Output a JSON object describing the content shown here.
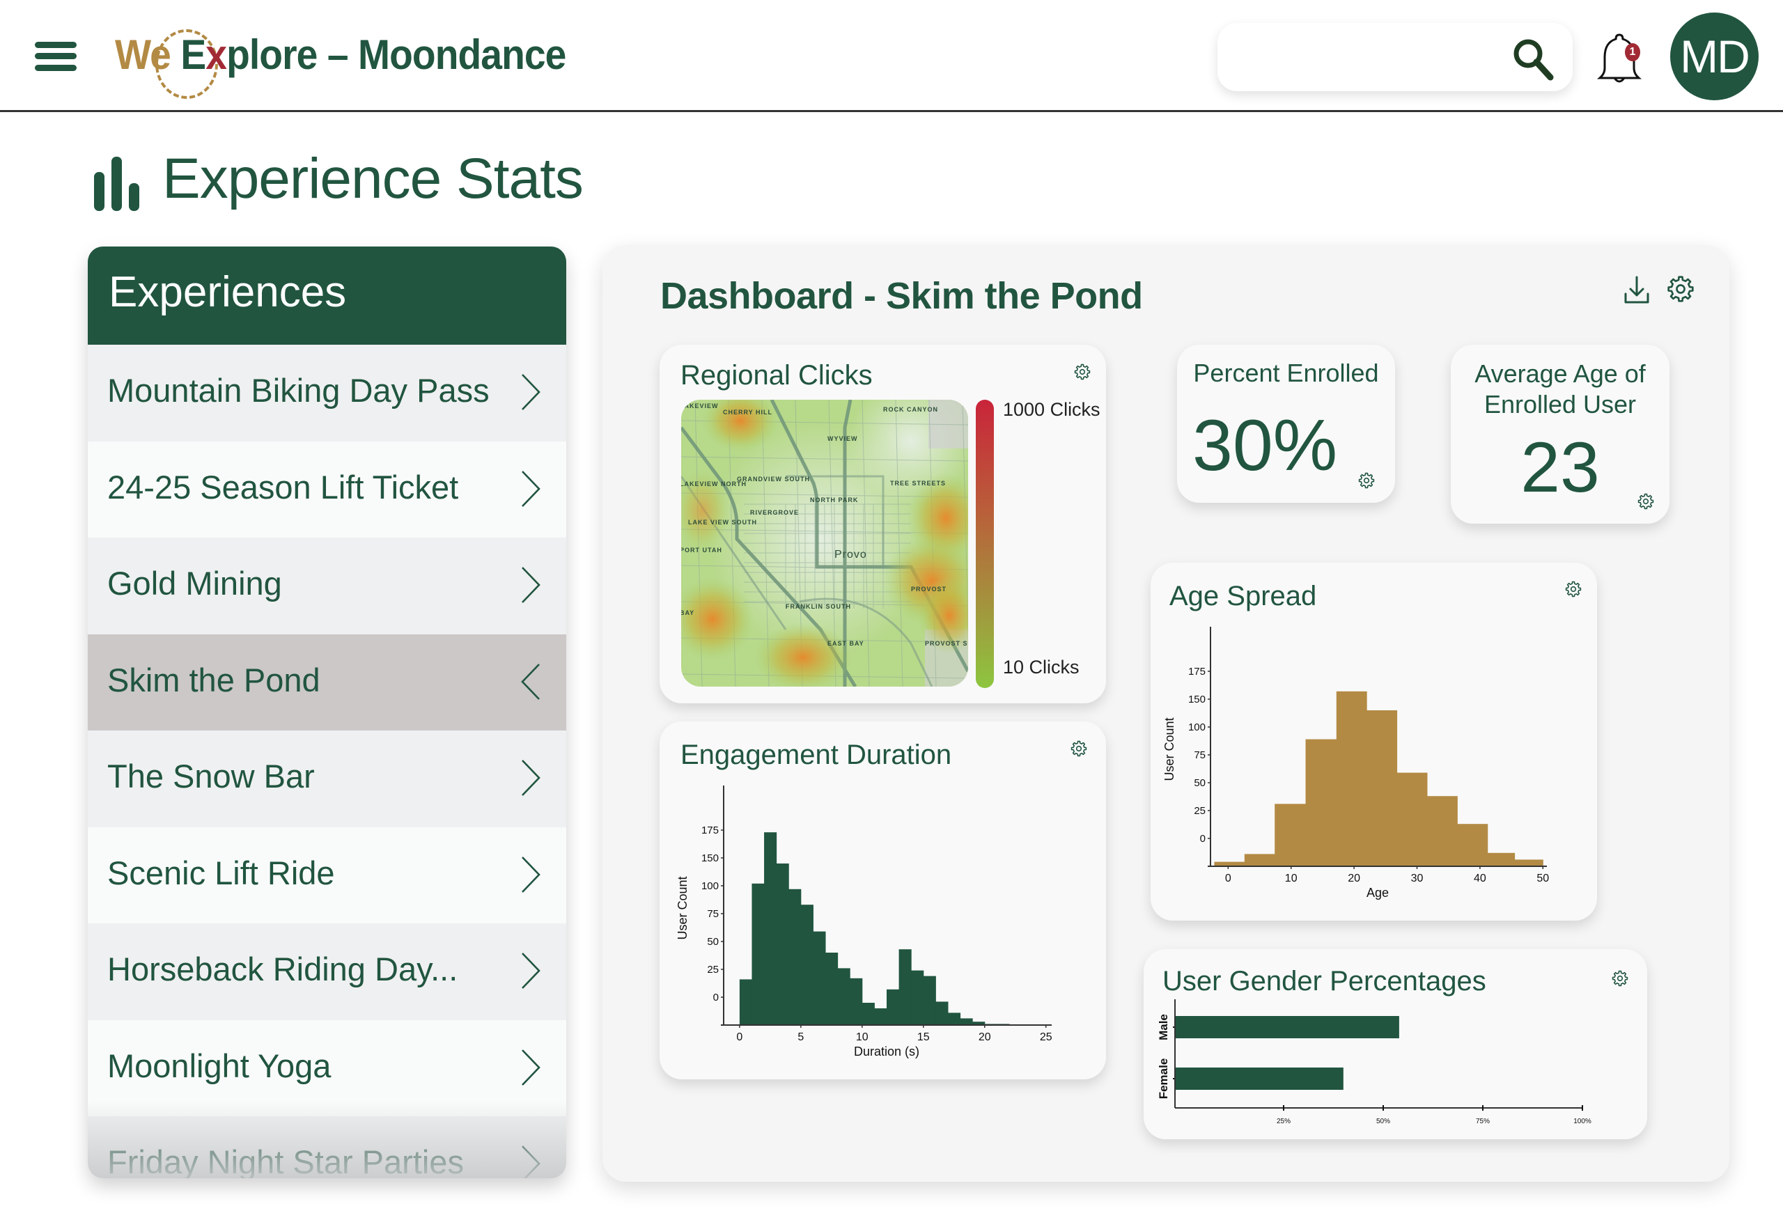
{
  "header": {
    "menu_icon": "hamburger-menu-icon",
    "logo": {
      "part1": "We",
      "part2": "E",
      "part3": "x",
      "part4": "plore – Moondance"
    },
    "search": {
      "value": "",
      "placeholder": "",
      "icon": "search-icon"
    },
    "notifications": {
      "icon": "bell-icon",
      "count": "1"
    },
    "avatar_initials": "MD"
  },
  "page": {
    "title_icon": "bar-chart-icon",
    "title": "Experience Stats"
  },
  "sidebar": {
    "heading": "Experiences",
    "items": [
      {
        "label": "Mountain Biking Day Pass",
        "active": false,
        "icon": "chevron-right-icon"
      },
      {
        "label": "24-25 Season Lift Ticket",
        "active": false,
        "icon": "chevron-right-icon"
      },
      {
        "label": "Gold Mining",
        "active": false,
        "icon": "chevron-right-icon"
      },
      {
        "label": "Skim the Pond",
        "active": true,
        "icon": "chevron-left-icon"
      },
      {
        "label": "The Snow Bar",
        "active": false,
        "icon": "chevron-right-icon"
      },
      {
        "label": "Scenic Lift Ride",
        "active": false,
        "icon": "chevron-right-icon"
      },
      {
        "label": "Horseback Riding Day...",
        "active": false,
        "icon": "chevron-right-icon"
      },
      {
        "label": "Moonlight Yoga",
        "active": false,
        "icon": "chevron-right-icon"
      },
      {
        "label": "Friday Night Star Parties",
        "active": false,
        "icon": "chevron-right-icon"
      }
    ]
  },
  "dashboard": {
    "title": "Dashboard - Skim the Pond",
    "actions": [
      "download-icon",
      "gear-icon"
    ],
    "regional_clicks": {
      "title": "Regional Clicks",
      "legend_max": "1000 Clicks",
      "legend_min": "10 Clicks",
      "colors": {
        "max": "#c9243a",
        "min": "#8dc63f"
      },
      "map_labels": [
        "LAKEVIEW",
        "CHERRY HILL",
        "ROCK CANYON",
        "WYVIEW",
        "GRANDVIEW SOUTH",
        "LAKEVIEW NORTH",
        "TREE STREETS",
        "NORTH PARK",
        "RIVERGROVE",
        "LAKE VIEW SOUTH",
        "PORT UTAH",
        "Provo",
        "PROVOST",
        "FRANKLIN SOUTH",
        "BAY",
        "EAST BAY",
        "PROVOST SO"
      ]
    },
    "percent_enrolled": {
      "title": "Percent Enrolled",
      "value": "30%"
    },
    "average_age": {
      "title": "Average Age of Enrolled User",
      "value": "23"
    }
  },
  "colors": {
    "brand_green": "#215540",
    "brand_gold": "#b38a44",
    "accent_red": "#a12a35",
    "active_row": "#cbc8c7"
  },
  "chart_data": [
    {
      "id": "engagement",
      "type": "bar",
      "title": "Engagement Duration",
      "xlabel": "Duration (s)",
      "ylabel": "User Count",
      "color": "#215540",
      "x_ticks": [
        0,
        5,
        10,
        15,
        20,
        25
      ],
      "y_tick_labels": [
        "0",
        "25",
        "50",
        "75",
        "100",
        "150",
        "175"
      ],
      "xlim": [
        -1.3,
        25.3
      ],
      "ylim": [
        -25,
        185
      ],
      "bins": [
        {
          "x0": 0,
          "x1": 1,
          "value": 16
        },
        {
          "x0": 1,
          "x1": 2,
          "value": 102
        },
        {
          "x0": 2,
          "x1": 3,
          "value": 148
        },
        {
          "x0": 3,
          "x1": 4,
          "value": 120
        },
        {
          "x0": 4,
          "x1": 5,
          "value": 97
        },
        {
          "x0": 5,
          "x1": 6,
          "value": 83
        },
        {
          "x0": 6,
          "x1": 7,
          "value": 59
        },
        {
          "x0": 7,
          "x1": 8,
          "value": 40
        },
        {
          "x0": 8,
          "x1": 9,
          "value": 26
        },
        {
          "x0": 9,
          "x1": 10,
          "value": 17
        },
        {
          "x0": 10,
          "x1": 11,
          "value": -5
        },
        {
          "x0": 11,
          "x1": 12,
          "value": -10
        },
        {
          "x0": 12,
          "x1": 13,
          "value": 7
        },
        {
          "x0": 13,
          "x1": 14,
          "value": 43
        },
        {
          "x0": 14,
          "x1": 15,
          "value": 24
        },
        {
          "x0": 15,
          "x1": 16,
          "value": 19
        },
        {
          "x0": 16,
          "x1": 17,
          "value": -4
        },
        {
          "x0": 17,
          "x1": 18,
          "value": -14
        },
        {
          "x0": 18,
          "x1": 19,
          "value": -19
        },
        {
          "x0": 19,
          "x1": 20,
          "value": -22
        },
        {
          "x0": 20,
          "x1": 22,
          "value": -24
        }
      ]
    },
    {
      "id": "age",
      "type": "bar",
      "title": "Age Spread",
      "xlabel": "Age",
      "ylabel": "User Count",
      "color": "#b38a44",
      "x_ticks": [
        0,
        10,
        20,
        30,
        40,
        50
      ],
      "y_tick_labels": [
        "0",
        "25",
        "50",
        "75",
        "100",
        "150",
        "175"
      ],
      "xlim": [
        -2.8,
        50.3
      ],
      "ylim": [
        -25,
        185
      ],
      "bins": [
        {
          "x0": -2.2,
          "x1": 2.6,
          "value": -21
        },
        {
          "x0": 2.6,
          "x1": 7.4,
          "value": -14
        },
        {
          "x0": 7.4,
          "x1": 12.3,
          "value": 31
        },
        {
          "x0": 12.3,
          "x1": 17.2,
          "value": 89
        },
        {
          "x0": 17.2,
          "x1": 22.0,
          "value": 132
        },
        {
          "x0": 22.0,
          "x1": 26.8,
          "value": 115
        },
        {
          "x0": 26.8,
          "x1": 31.6,
          "value": 59
        },
        {
          "x0": 31.6,
          "x1": 36.4,
          "value": 38
        },
        {
          "x0": 36.4,
          "x1": 41.2,
          "value": 13
        },
        {
          "x0": 41.2,
          "x1": 45.5,
          "value": -13
        },
        {
          "x0": 45.5,
          "x1": 50.0,
          "value": -19
        }
      ]
    },
    {
      "id": "gender",
      "type": "bar",
      "orientation": "horizontal",
      "title": "User Gender Percentages",
      "categories": [
        "Male",
        "Female"
      ],
      "values": [
        54,
        40
      ],
      "unit": "%",
      "color": "#215540",
      "x_ticks": [
        "25%",
        "50%",
        "75%",
        "100%"
      ],
      "xlim": [
        0,
        100
      ]
    }
  ]
}
